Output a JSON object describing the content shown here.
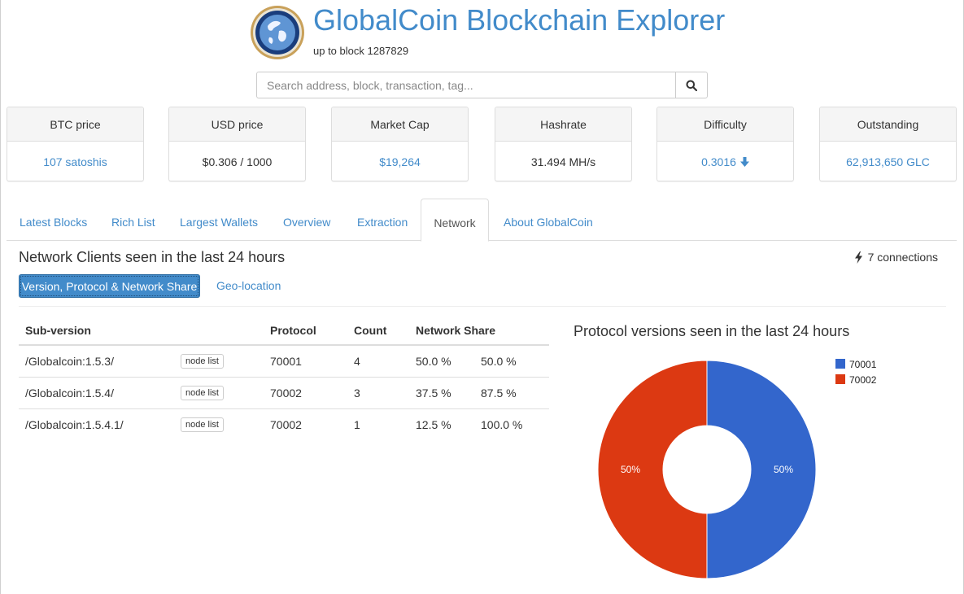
{
  "header": {
    "title": "GlobalCoin Blockchain Explorer",
    "subtitle": "up to block 1287829"
  },
  "search": {
    "placeholder": "Search address, block, transaction, tag..."
  },
  "stats": [
    {
      "label": "BTC price",
      "value": "107 satoshis",
      "style": "link"
    },
    {
      "label": "USD price",
      "value": "$0.306 / 1000",
      "style": "plain"
    },
    {
      "label": "Market Cap",
      "value": "$19,264",
      "style": "link"
    },
    {
      "label": "Hashrate",
      "value": "31.494 MH/s",
      "style": "plain"
    },
    {
      "label": "Difficulty",
      "value": "0.3016",
      "style": "link",
      "icon": "arrow-down-icon"
    },
    {
      "label": "Outstanding",
      "value": "62,913,650 GLC",
      "style": "link"
    }
  ],
  "tabs": [
    {
      "label": "Latest Blocks",
      "active": false
    },
    {
      "label": "Rich List",
      "active": false
    },
    {
      "label": "Largest Wallets",
      "active": false
    },
    {
      "label": "Overview",
      "active": false
    },
    {
      "label": "Extraction",
      "active": false
    },
    {
      "label": "Network",
      "active": true
    },
    {
      "label": "About GlobalCoin",
      "active": false
    }
  ],
  "network": {
    "title": "Network Clients seen in the last 24 hours",
    "connections": "7 connections",
    "pills": [
      "Version, Protocol & Network Share",
      "Geo-location"
    ],
    "table": {
      "headers": [
        "Sub-version",
        "",
        "Protocol",
        "Count",
        "Network Share",
        ""
      ],
      "rows": [
        {
          "subversion": "/Globalcoin:1.5.3/",
          "button": "node list",
          "protocol": "70001",
          "count": "4",
          "share": "50.0 %",
          "cumulative": "50.0 %"
        },
        {
          "subversion": "/Globalcoin:1.5.4/",
          "button": "node list",
          "protocol": "70002",
          "count": "3",
          "share": "37.5 %",
          "cumulative": "87.5 %"
        },
        {
          "subversion": "/Globalcoin:1.5.4.1/",
          "button": "node list",
          "protocol": "70002",
          "count": "1",
          "share": "12.5 %",
          "cumulative": "100.0 %"
        }
      ]
    }
  },
  "chart_data": {
    "type": "pie",
    "title": "Protocol versions seen in the last 24 hours",
    "donut": true,
    "legend_position": "top-right",
    "categories": [
      "70001",
      "70002"
    ],
    "values": [
      50,
      50
    ],
    "labels": [
      "50%",
      "50%"
    ],
    "colors": [
      "#3366cc",
      "#dc3912"
    ]
  }
}
